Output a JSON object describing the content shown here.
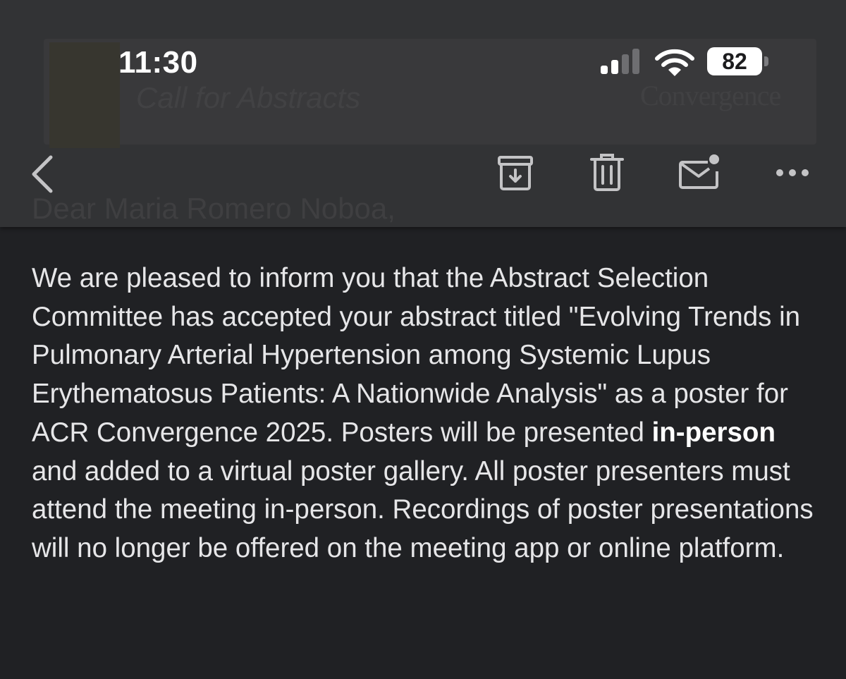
{
  "status_bar": {
    "time": "11:30",
    "battery_level": "82",
    "icons": [
      "cellular-signal-icon",
      "wifi-icon",
      "battery-icon"
    ]
  },
  "background_preview": {
    "banner_title": "Call for Abstracts",
    "banner_brand": "Convergence",
    "greeting": "Dear Maria Romero Noboa,"
  },
  "toolbar": {
    "icons": [
      "back-chevron-icon",
      "archive-icon",
      "trash-icon",
      "mark-unread-icon",
      "more-icon"
    ]
  },
  "email": {
    "body_part1": "We are pleased to inform you that the Abstract Selection Committee has accepted your abstract titled \"Evolving Trends in Pulmonary Arterial Hypertension among Systemic Lupus Erythematosus Patients: A Nationwide Analysis\" as a poster for ACR Convergence 2025. Posters will be presented ",
    "body_bold": "in-person",
    "body_part2": " and added to a virtual poster gallery. All poster presenters must attend the meeting in-person. Recordings of poster presentations will no longer be offered on the meeting app or online platform."
  },
  "colors": {
    "background": "#202124",
    "toolbar": "#323335",
    "icon": "#c4c4c6",
    "text": "#e6e6e8"
  }
}
